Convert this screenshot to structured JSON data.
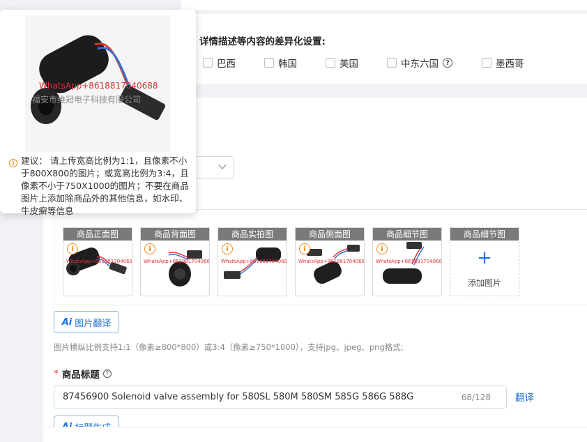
{
  "diff_section": {
    "title": "详情描述等内容的差异化设置:",
    "countries": [
      {
        "label": "巴西"
      },
      {
        "label": "韩国"
      },
      {
        "label": "美国"
      },
      {
        "label": "中东六国",
        "has_help": true
      },
      {
        "label": "墨西哥"
      }
    ]
  },
  "popover": {
    "watermark_red": "WhatsApp+8618817040688",
    "watermark_gray": "福安市维冠电子科技有限公司",
    "suggestion": "建议： 请上传宽高比例为1:1，且像素不小于800X800的图片；或宽高比例为3:4，且像素不小于750X1000的图片；不要在商品图片上添加除商品外的其他信息，如水印、牛皮癣等信息"
  },
  "thumbnails": [
    {
      "caption": "商品正面图",
      "watermark": "WhatsApp+8618817040688"
    },
    {
      "caption": "商品背面图",
      "watermark": "WhatsApp+8618817040688"
    },
    {
      "caption": "商品实拍图",
      "watermark": "WhatsApp+8618817040688"
    },
    {
      "caption": "商品侧面图",
      "watermark": "WhatsApp+8618817040688"
    },
    {
      "caption": "商品细节图",
      "watermark": "WhatsApp+8618817040688"
    }
  ],
  "add_slot": {
    "caption": "商品细节图",
    "plus": "+",
    "label": "添加图片"
  },
  "buttons": {
    "image_translate": "图片翻译",
    "title_generate": "标题生成",
    "ai_mark": "Ai"
  },
  "image_hint": "图片横纵比例支持1:1（像素≥800*800）或3:4（像素≥750*1000），支持jpg、jpeg、png格式;",
  "title_field": {
    "required_mark": "*",
    "label": "商品标题",
    "value": "87456900 Solenoid valve assembly for 580SL 580M 580SM 585G 586G 588G",
    "count": "68/128",
    "translate_link": "翻译"
  },
  "colors": {
    "accent": "#1e6fd9",
    "warning": "#f08c1a",
    "required": "#e0303a"
  }
}
